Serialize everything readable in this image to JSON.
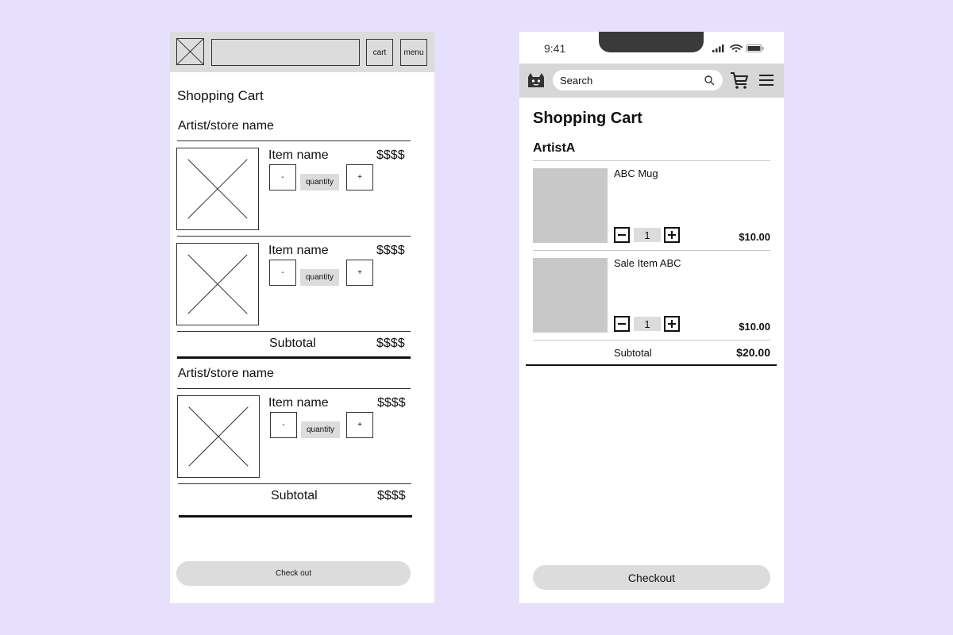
{
  "wireframe": {
    "cart_label": "cart",
    "menu_label": "menu",
    "title": "Shopping Cart",
    "stores": [
      {
        "name": "Artist/store name",
        "items": [
          {
            "name": "Item name",
            "price": "$$$$",
            "minus": "-",
            "quantity": "quantity",
            "plus": "+"
          },
          {
            "name": "Item name",
            "price": "$$$$",
            "minus": "-",
            "quantity": "quantity",
            "plus": "+"
          }
        ],
        "subtotal_label": "Subtotal",
        "subtotal_value": "$$$$"
      },
      {
        "name": "Artist/store name",
        "items": [
          {
            "name": "Item name",
            "price": "$$$$",
            "minus": "-",
            "quantity": "quantity",
            "plus": "+"
          }
        ],
        "subtotal_label": "Subtotal",
        "subtotal_value": "$$$$"
      }
    ],
    "checkout_label": "Check out"
  },
  "mockup": {
    "status_time": "9:41",
    "search_placeholder": "Search",
    "title": "Shopping Cart",
    "artist": "ArtistA",
    "items": [
      {
        "name": "ABC Mug",
        "quantity": "1",
        "price": "$10.00"
      },
      {
        "name": "Sale Item ABC",
        "quantity": "1",
        "price": "$10.00"
      }
    ],
    "subtotal_label": "Subtotal",
    "subtotal_value": "$20.00",
    "checkout_label": "Checkout"
  },
  "colors": {
    "background": "#e6e0fc",
    "placeholder_gray": "#dcdcdc",
    "image_gray": "#c8c8c8"
  }
}
